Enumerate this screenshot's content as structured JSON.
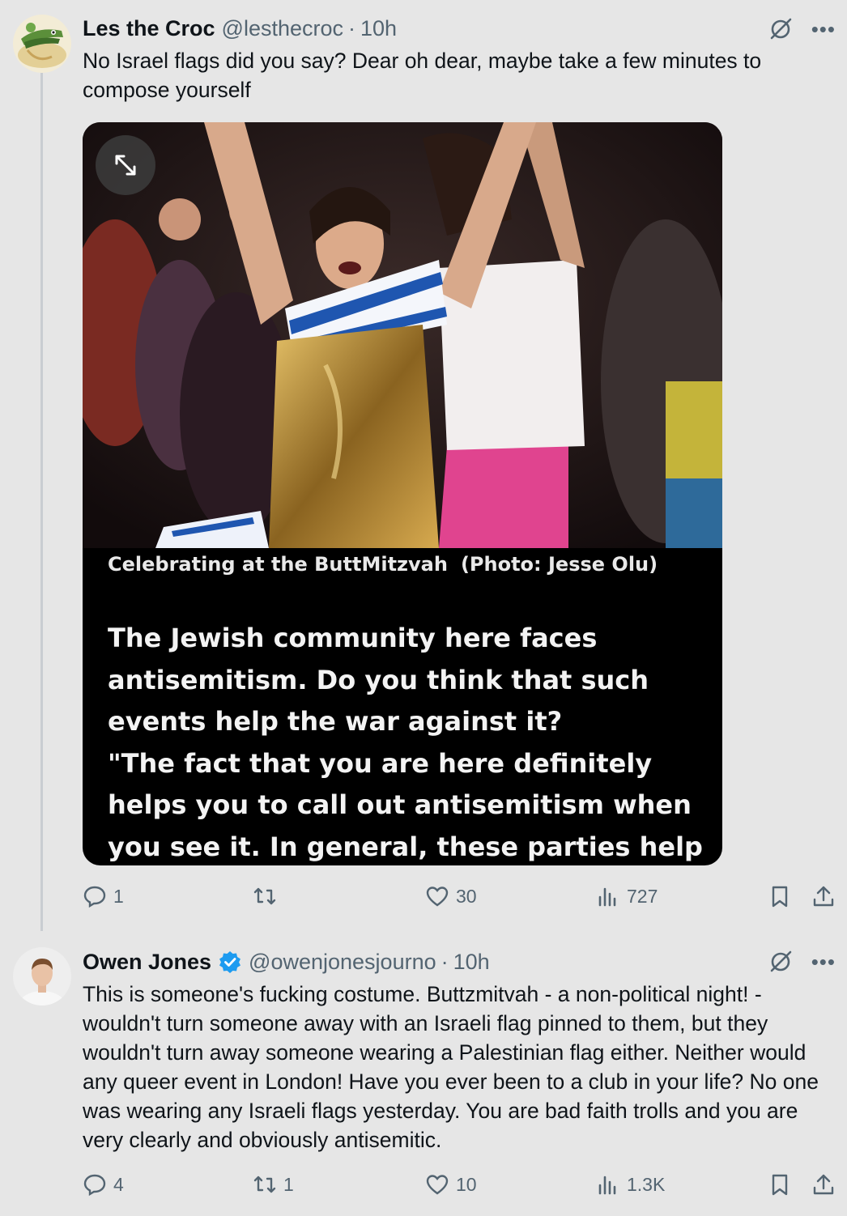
{
  "tweets": [
    {
      "author_name": "Les the Croc",
      "handle": "@lesthecroc",
      "time": "10h",
      "text": "No Israel flags did you say? Dear oh dear, maybe take a few minutes to compose yourself",
      "media": {
        "caption": "Celebrating at the ButtMitzvah",
        "credit": "(Photo: Jesse Olu)",
        "article_lines": [
          "The Jewish community here faces",
          "antisemitism. Do you think that such",
          "events help the war against it?",
          "\"The fact that you are here definitely",
          "helps you to call out antisemitism when",
          "you see it. In general, these parties help"
        ]
      },
      "actions": {
        "replies": "1",
        "retweets": "",
        "likes": "30",
        "views": "727"
      }
    },
    {
      "author_name": "Owen Jones",
      "handle": "@owenjonesjourno",
      "time": "10h",
      "verified": true,
      "text": "This is someone's fucking costume. Buttzmitvah - a non-political night! - wouldn't turn someone away with an Israeli flag pinned to them, but they wouldn't turn away someone wearing a Palestinian flag either. Neither would any queer event in London! Have you ever been to a club in your life? No one was wearing any Israeli flags yesterday. You are bad faith trolls and you are very clearly and obviously antisemitic.",
      "actions": {
        "replies": "4",
        "retweets": "1",
        "likes": "10",
        "views": "1.3K"
      }
    }
  ],
  "colors": {
    "background": "#e6e6e6",
    "text": "#0f1419",
    "secondary": "#536471",
    "verified": "#1d9bf0"
  },
  "icons": [
    "grok-icon",
    "more-icon",
    "expand-icon",
    "reply-icon",
    "retweet-icon",
    "like-icon",
    "views-icon",
    "bookmark-icon",
    "share-icon",
    "verified-badge-icon"
  ]
}
